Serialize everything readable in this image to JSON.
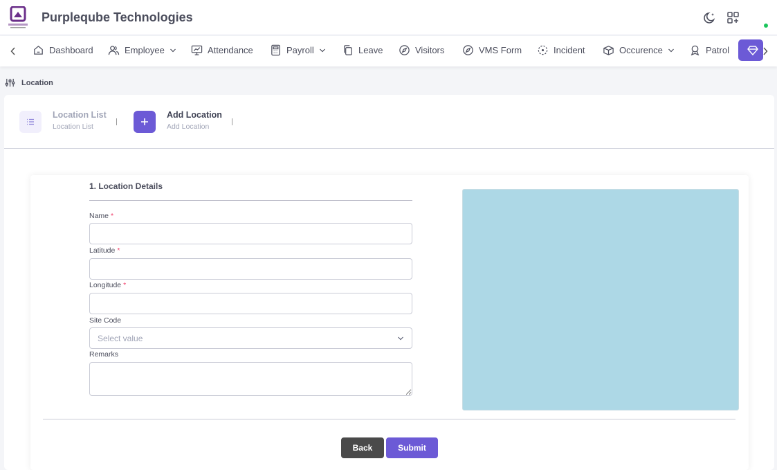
{
  "app": {
    "brand": "Purpleqube Technologies",
    "logo_text": "PURPLE QUBE"
  },
  "colors": {
    "accent": "#6c5ad6",
    "map_placeholder": "#add8e6",
    "status_online": "#1bc55c"
  },
  "header": {
    "icons": [
      "moon-icon",
      "apps-add-icon"
    ]
  },
  "nav": {
    "items": [
      {
        "label": "Dashboard",
        "icon": "home-icon",
        "dropdown": false
      },
      {
        "label": "Employee",
        "icon": "users-icon",
        "dropdown": true
      },
      {
        "label": "Attendance",
        "icon": "monitor-chart-icon",
        "dropdown": false
      },
      {
        "label": "Payroll",
        "icon": "calculator-icon",
        "dropdown": true
      },
      {
        "label": "Leave",
        "icon": "copy-icon",
        "dropdown": false
      },
      {
        "label": "Visitors",
        "icon": "compass-icon",
        "dropdown": false
      },
      {
        "label": "VMS Form",
        "icon": "compass-icon",
        "dropdown": false
      },
      {
        "label": "Incident",
        "icon": "focus-icon",
        "dropdown": false
      },
      {
        "label": "Occurence",
        "icon": "package-icon",
        "dropdown": true
      },
      {
        "label": "Patrol",
        "icon": "badge-icon",
        "dropdown": false
      }
    ],
    "active_icon": "diamond-icon"
  },
  "breadcrumb": {
    "label": "Location"
  },
  "steps": {
    "list": {
      "title": "Location List",
      "subtitle": "Location List"
    },
    "add": {
      "title": "Add Location",
      "subtitle": "Add Location"
    }
  },
  "form": {
    "section_title": "1. Location Details",
    "required_mark": "*",
    "name_label": "Name",
    "name_value": "",
    "latitude_label": "Latitude",
    "latitude_value": "",
    "longitude_label": "Longitude",
    "longitude_value": "",
    "sitecode_label": "Site Code",
    "sitecode_placeholder": "Select value",
    "remarks_label": "Remarks",
    "remarks_value": ""
  },
  "buttons": {
    "back": "Back",
    "submit": "Submit"
  }
}
